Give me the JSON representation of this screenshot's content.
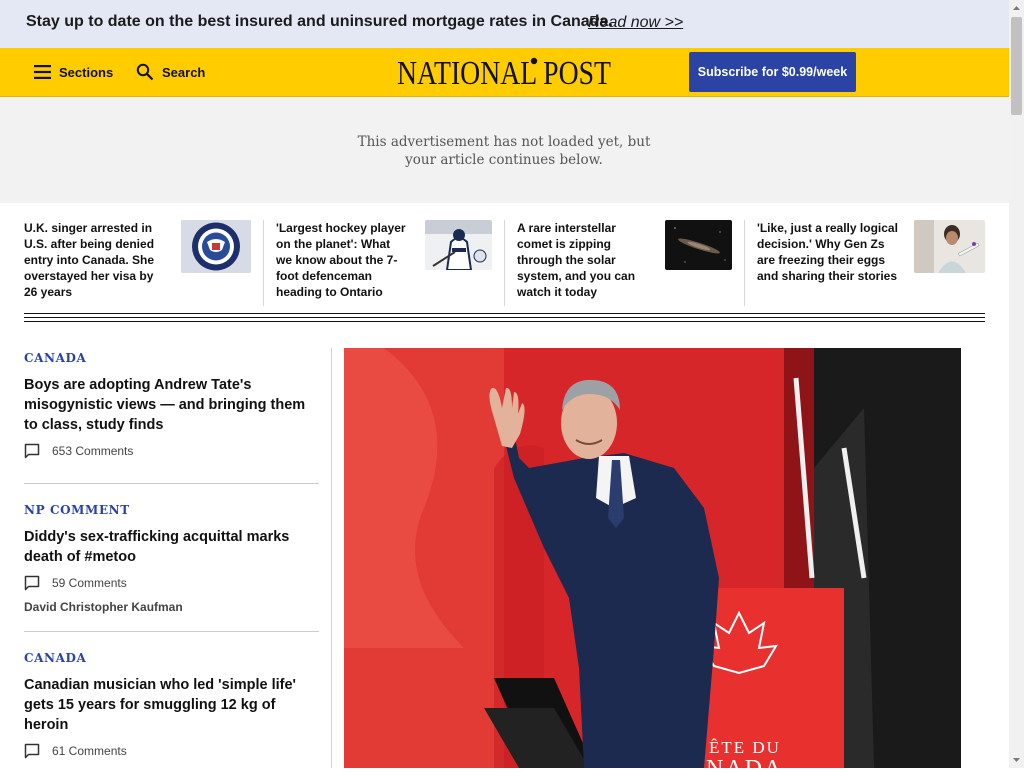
{
  "promo": {
    "text": "Stay up to date on the best insured and uninsured mortgage rates in Canada.",
    "link": "Read now >>"
  },
  "header": {
    "sections_label": "Sections",
    "search_label": "Search",
    "logo_text": "NATIONAL POST",
    "subscribe_label": "Subscribe for $0.99/week"
  },
  "ad": {
    "message": "This advertisement has not loaded yet, but your article continues below."
  },
  "trending": [
    {
      "title": "U.K. singer arrested in U.S. after being denied entry into Canada. She overstayed her visa by 26 years",
      "image": "homeland-security-seal"
    },
    {
      "title": "'Largest hockey player on the planet': What we know about the 7-foot defenceman heading to Ontario",
      "image": "hockey-player-photo"
    },
    {
      "title": "A rare interstellar comet is zipping through the solar system, and you can watch it today",
      "image": "comet-illustration"
    },
    {
      "title": "'Like, just a really logical decision.' Why Gen Zs are freezing their eggs and sharing their stories",
      "image": "egg-freezing-photo"
    }
  ],
  "stories": [
    {
      "kicker": "CANADA",
      "headline": "Boys are adopting Andrew Tate's misogynistic views — and bringing them to class, study finds",
      "comments": "653 Comments",
      "byline": ""
    },
    {
      "kicker": "NP COMMENT",
      "headline": "Diddy's sex-trafficking acquittal marks death of #metoo",
      "comments": "59 Comments",
      "byline": "David Christopher Kaufman"
    },
    {
      "kicker": "CANADA",
      "headline": "Canadian musician who led 'simple life' gets 15 years for smuggling 12 kg of heroin",
      "comments": "61 Comments",
      "byline": ""
    }
  ],
  "hero": {
    "image": "man-waving-on-red-stage-photo",
    "sign_text_1": "ÊTE DU",
    "sign_text_2": "NADA"
  },
  "colors": {
    "header_yellow": "#ffcc00",
    "promo_bg": "#e4e8f4",
    "accent_blue": "#2a43a4"
  }
}
